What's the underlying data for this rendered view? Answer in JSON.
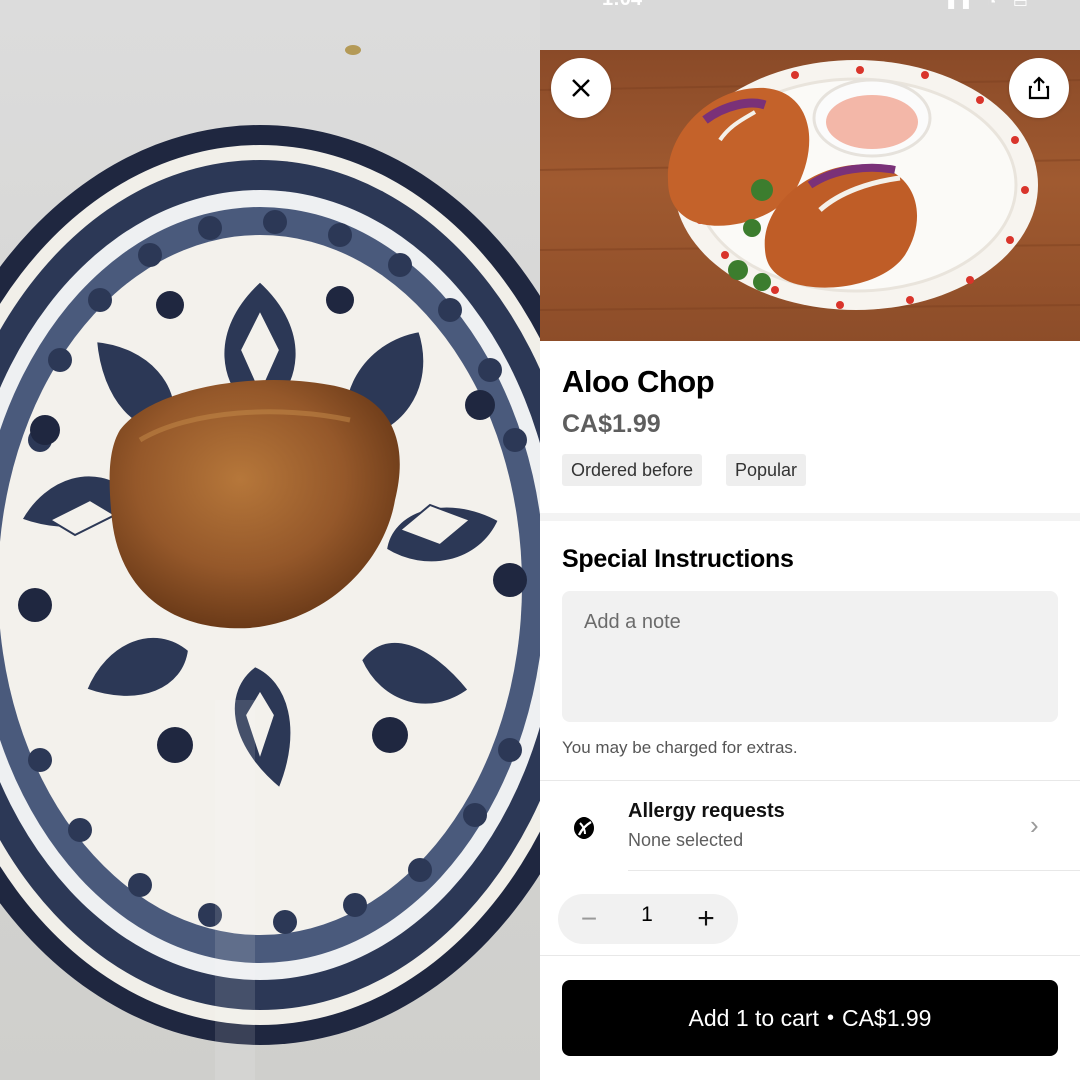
{
  "status_bar": {
    "time": "1:04",
    "icons": [
      "signal-icon",
      "wifi-icon",
      "battery-icon"
    ]
  },
  "photo": {
    "description_icon": "plated-food-photo"
  },
  "header": {
    "close_icon": "close-icon",
    "share_icon": "share-icon"
  },
  "item": {
    "title": "Aloo Chop",
    "price": "CA$1.99",
    "badges": [
      "Ordered before",
      "Popular"
    ]
  },
  "special_instructions": {
    "title": "Special Instructions",
    "placeholder": "Add a note",
    "note": "You may be charged for extras."
  },
  "allergy": {
    "title": "Allergy requests",
    "subtitle": "None selected",
    "icon": "allergy-leaf-icon"
  },
  "quantity": {
    "value": "1",
    "minus": "−",
    "plus": "+"
  },
  "cart_button": {
    "label": "Add 1 to cart",
    "separator": "•",
    "price": "CA$1.99"
  },
  "colors": {
    "button_bg": "#000000",
    "badge_bg": "#eeeeee",
    "input_bg": "#f1f1f1"
  }
}
